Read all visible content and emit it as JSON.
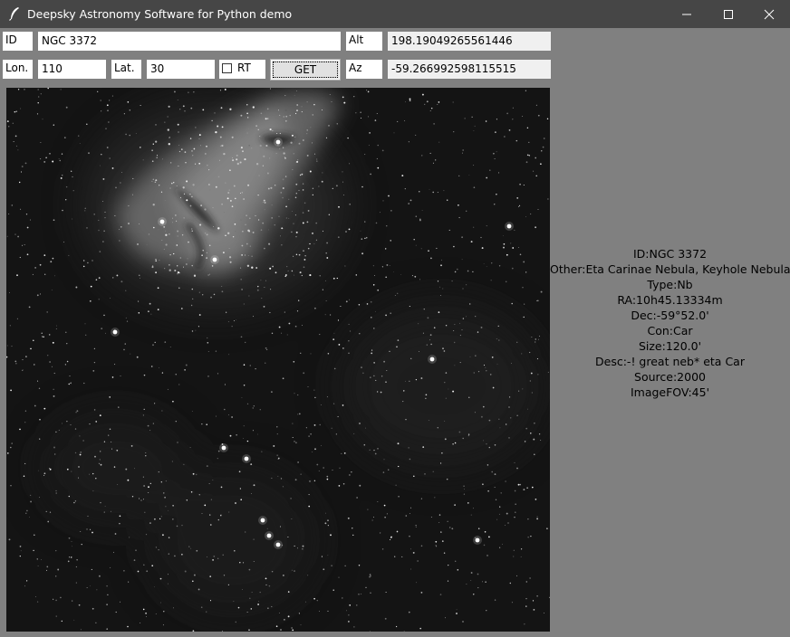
{
  "window": {
    "title": "Deepsky Astronomy Software for Python demo",
    "icon": "feather-icon",
    "controls": [
      "minimize-icon",
      "maximize-icon",
      "close-icon"
    ]
  },
  "form": {
    "id_label": "ID",
    "id_value": "NGC 3372",
    "alt_label": "Alt",
    "alt_value": "198.19049265561446",
    "lon_label": "Lon.",
    "lon_value": "110",
    "lat_label": "Lat.",
    "lat_value": "30",
    "rt_label": "RT",
    "rt_checked": false,
    "get_label": "GET",
    "az_label": "Az",
    "az_value": "-59.266992598115515"
  },
  "info": {
    "id": "ID:NGC 3372",
    "other": "Other:Eta Carinae Nebula, Keyhole Nebula",
    "type": "Type:Nb",
    "ra": "RA:10h45.13334m",
    "dec": "Dec:-59°52.0'",
    "con": "Con:Car",
    "size": "Size:120.0'",
    "desc": "Desc:-! great neb* eta Car",
    "source": "Source:2000",
    "fov": "ImageFOV:45'"
  }
}
